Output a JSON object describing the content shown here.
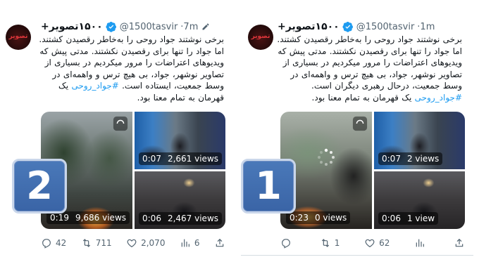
{
  "tweets": [
    {
      "display_name": "۱۵۰۰تصویر+",
      "handle": "@1500tasvir",
      "time": "·7m",
      "edited": true,
      "avatar_text": "تصویر",
      "text_before": "برخی نوشتند جواد روحی را به‌خاطر رقصیدن کشتند. اما جواد را تنها برای رقصیدن نکشتند. مدتی پیش که ویدیوهای اعتراضات را مرور میکردیم در بسیاری از تصاویر نوشهر، جواد، بی هیچ ترس و واهمه‌ای در وسط جمعیت، ایستاده است. ",
      "hashtag": "#جواد_روحی",
      "text_after": " یک قهرمان به تمام معنا بود.",
      "badge_number": "2",
      "media": {
        "big": {
          "duration": "0:19",
          "views": "9,686 views"
        },
        "top_right": {
          "duration": "0:07",
          "views": "2,661 views"
        },
        "bottom_right": {
          "duration": "0:06",
          "views": "2,467 views"
        }
      },
      "actions": {
        "replies": "42",
        "retweets": "711",
        "likes": "2,070",
        "views": "6"
      }
    },
    {
      "display_name": "۱۵۰۰تصویر+",
      "handle": "@1500tasvir",
      "time": "·1m",
      "edited": false,
      "avatar_text": "تصویر",
      "text_before": "برخی نوشتند جواد روحی را به‌خاطر رقصیدن کشتند. اما جواد را تنها برای رقصیدن نکشتند. مدتی پیش که ویدیوهای اعتراضات را مرور میکردیم در بسیاری از تصاویر نوشهر، جواد، بی هیچ ترس و واهمه‌ای در وسط جمعیت، درحال رهبری دیگران است. ",
      "hashtag": "#جواد_روحی",
      "text_after": " یک قهرمان به تمام معنا بود.",
      "badge_number": "1",
      "media": {
        "big": {
          "duration": "0:23",
          "views": "0 views"
        },
        "top_right": {
          "duration": "0:07",
          "views": "2 views"
        },
        "bottom_right": {
          "duration": "0:06",
          "views": "1 view"
        }
      },
      "actions": {
        "replies": "",
        "retweets": "1",
        "likes": "62",
        "views": ""
      }
    }
  ],
  "colors": {
    "verified": "#1d9bf0",
    "hashtag": "#1d9bf0",
    "secondary_text": "#536471",
    "badge_blue": "#3f6cae"
  }
}
